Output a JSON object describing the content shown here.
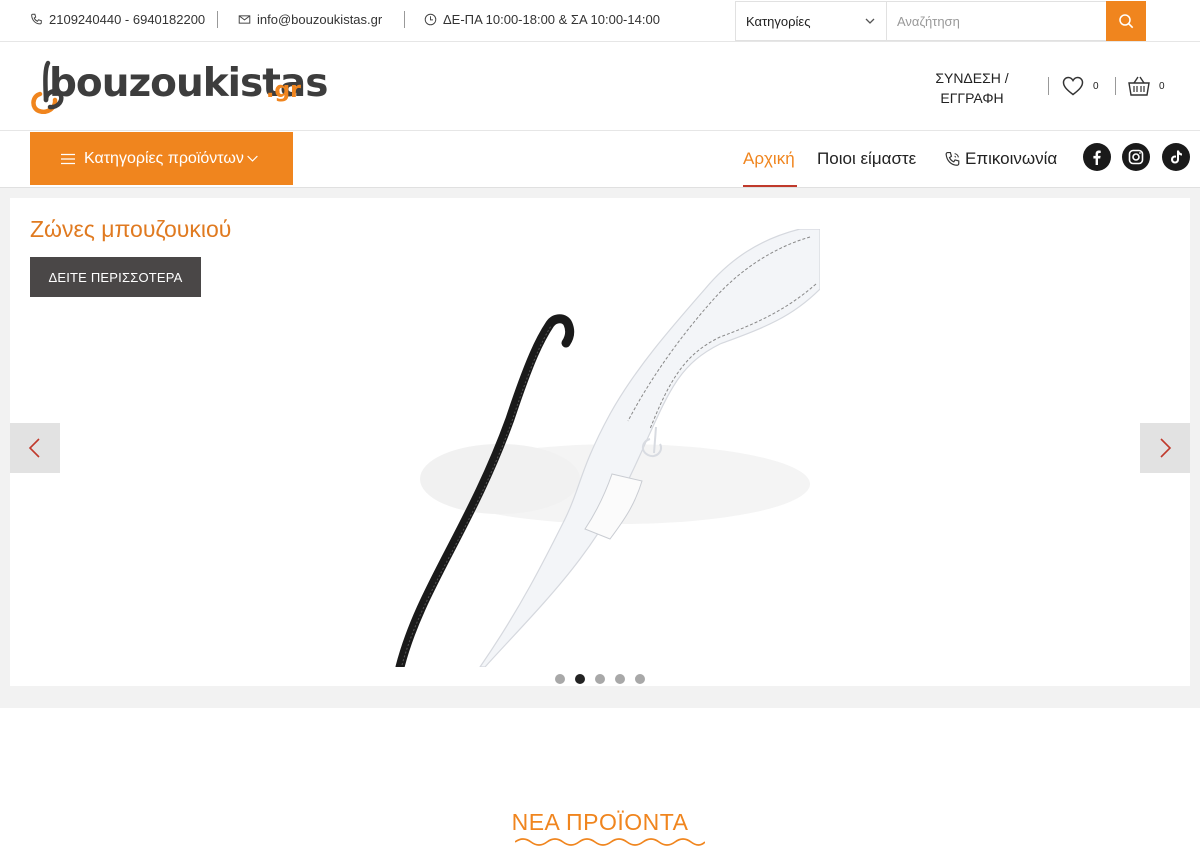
{
  "topbar": {
    "phone": "2109240440 - 6940182200",
    "email": "info@bouzoukistas.gr",
    "hours": "ΔΕ-ΠΑ 10:00-18:00 & ΣΑ 10:00-14:00",
    "category_select": "Κατηγορίες",
    "search_placeholder": "Αναζήτηση",
    "icons": [
      "phone-icon",
      "mail-icon",
      "clock-icon",
      "chevron-down-icon",
      "search-icon"
    ]
  },
  "header": {
    "logo_text": "bouzoukistas",
    "logo_tld": ".gr",
    "login_line1": "ΣΥΝΔΕΣΗ /",
    "login_line2": "ΕΓΓΡΑΦΗ",
    "wishlist_count": "0",
    "cart_count": "0",
    "icons": [
      "heart-icon",
      "basket-icon"
    ]
  },
  "nav": {
    "categories_button": "Κατηγορίες προϊόντων",
    "links": [
      {
        "label": "Αρχική",
        "active": true
      },
      {
        "label": "Ποιοι είμαστε",
        "active": false
      },
      {
        "label": "Επικοινωνία",
        "active": false
      }
    ],
    "social": [
      "facebook-icon",
      "instagram-icon",
      "tiktok-icon"
    ]
  },
  "slider": {
    "title": "Ζώνες μπουζουκιού",
    "cta": "ΔΕΙΤΕ ΠΕΡΙΣΣΟΤΕΡΑ",
    "slide_count": 5,
    "active_slide_index": 1,
    "image_subject": "white leather bouzouki strap with black cord"
  },
  "sections": {
    "new_products_title": "ΝΕΑ ΠΡΟΪΟΝΤΑ"
  },
  "colors": {
    "accent": "#f0851e",
    "title_orange": "#e07a20",
    "cta_dark": "#4a4747",
    "nav_underline": "#c0392b"
  }
}
